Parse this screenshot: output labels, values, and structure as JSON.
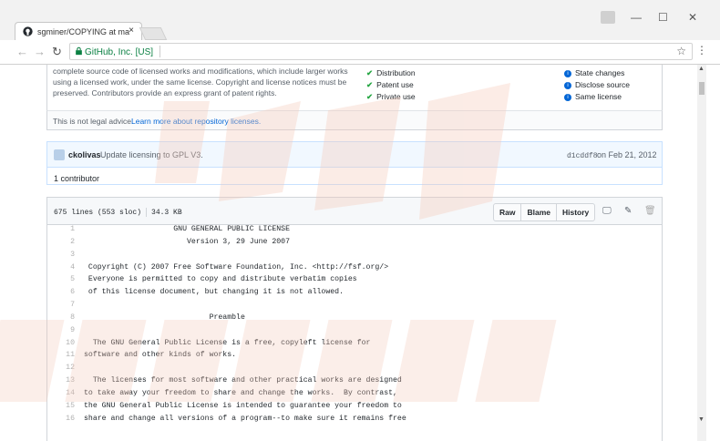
{
  "browser": {
    "tab_title": "sgminer/COPYING at ma",
    "tab_close": "×",
    "site_name": "GitHub, Inc. [US]",
    "nav": {
      "back": "←",
      "forward": "→",
      "reload": "↻"
    },
    "star": "☆",
    "menu": "⋮",
    "window": {
      "minimize": "—",
      "maximize": "☐",
      "close": "✕"
    }
  },
  "license": {
    "description": "complete source code of licensed works and modifications, which include larger works using a licensed work, under the same license. Copyright and license notices must be preserved. Contributors provide an express grant of patent rights.",
    "permissions": [
      "Distribution",
      "Patent use",
      "Private use"
    ],
    "conditions": [
      "State changes",
      "Disclose source",
      "Same license"
    ],
    "legal_prefix": "This is not legal advice.",
    "legal_link": "Learn more about repository licenses."
  },
  "commit": {
    "author": "ckolivas",
    "message": "Update licensing to GPL V3.",
    "sha": "d1cddf8",
    "date": "on Feb 21, 2012",
    "contributors": "1 contributor"
  },
  "file": {
    "lines_info": "675 lines (553 sloc)",
    "size": "34.3 KB",
    "buttons": {
      "raw": "Raw",
      "blame": "Blame",
      "history": "History"
    },
    "icons": {
      "desktop": "🖵",
      "edit": "✎",
      "delete": "🗑"
    }
  },
  "code_lines": [
    {
      "n": "1",
      "t": "                    GNU GENERAL PUBLIC LICENSE"
    },
    {
      "n": "2",
      "t": "                       Version 3, 29 June 2007"
    },
    {
      "n": "3",
      "t": ""
    },
    {
      "n": "4",
      "t": " Copyright (C) 2007 Free Software Foundation, Inc. <http://fsf.org/>"
    },
    {
      "n": "5",
      "t": " Everyone is permitted to copy and distribute verbatim copies"
    },
    {
      "n": "6",
      "t": " of this license document, but changing it is not allowed."
    },
    {
      "n": "7",
      "t": ""
    },
    {
      "n": "8",
      "t": "                            Preamble"
    },
    {
      "n": "9",
      "t": ""
    },
    {
      "n": "10",
      "t": "  The GNU General Public License is a free, copyleft license for"
    },
    {
      "n": "11",
      "t": "software and other kinds of works."
    },
    {
      "n": "12",
      "t": ""
    },
    {
      "n": "13",
      "t": "  The licenses for most software and other practical works are designed"
    },
    {
      "n": "14",
      "t": "to take away your freedom to share and change the works.  By contrast,"
    },
    {
      "n": "15",
      "t": "the GNU General Public License is intended to guarantee your freedom to"
    },
    {
      "n": "16",
      "t": "share and change all versions of a program--to make sure it remains free"
    }
  ],
  "colors": {
    "accent": "#0366d6",
    "secure_green": "#0b8043",
    "check_green": "#28a745",
    "watermark": "#f5c9b8"
  }
}
